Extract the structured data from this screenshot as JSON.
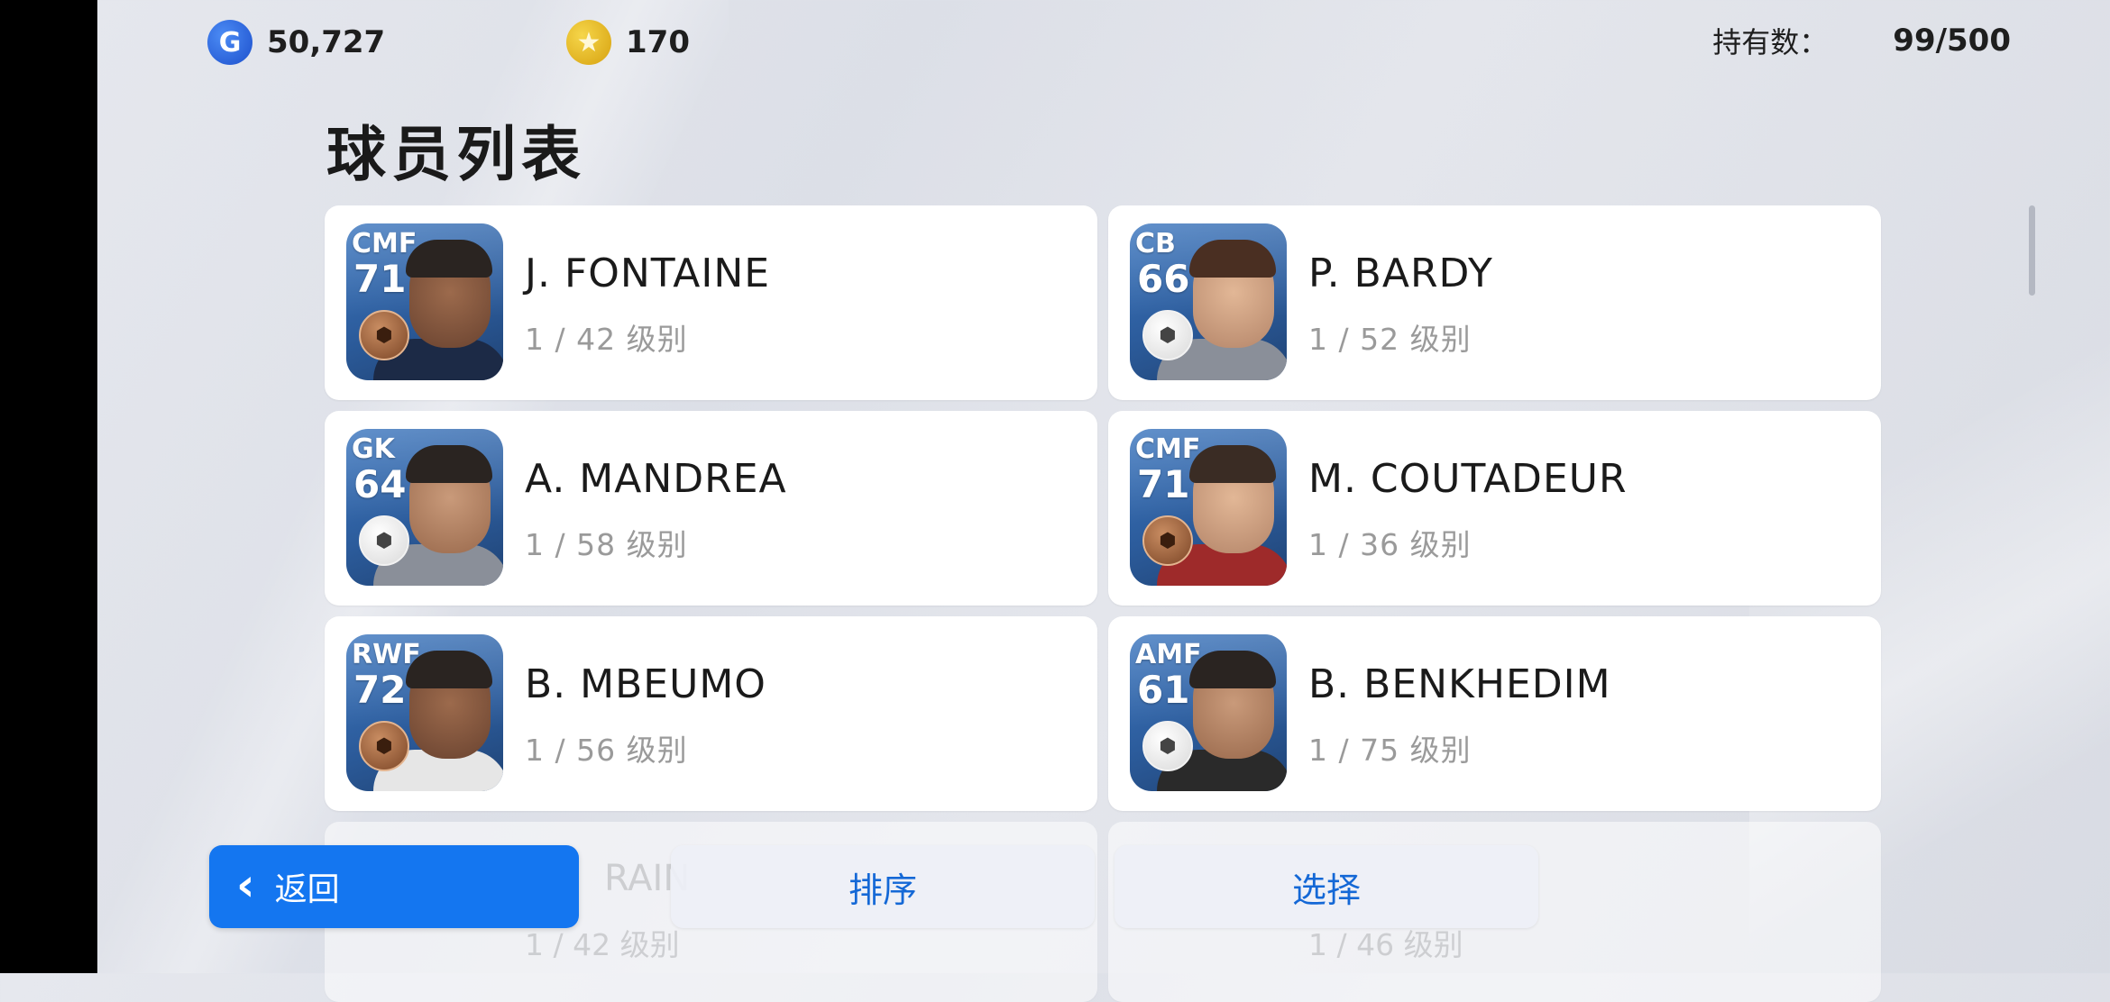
{
  "currency": {
    "gp_icon": "G",
    "gp": "50,727",
    "coins_icon": "★",
    "coins": "170"
  },
  "owned": {
    "label": "持有数：",
    "value": "99/500"
  },
  "page_title": "球员列表",
  "players": [
    {
      "position": "CMF",
      "rating": "71",
      "name": "J. FONTAINE",
      "level": "1 / 42 级别",
      "badge": "bronze",
      "icon": "player-portrait"
    },
    {
      "position": "CB",
      "rating": "66",
      "name": "P. BARDY",
      "level": "1 / 52 级别",
      "badge": "white",
      "icon": "player-portrait"
    },
    {
      "position": "GK",
      "rating": "64",
      "name": "A. MANDREA",
      "level": "1 / 58 级别",
      "badge": "white",
      "icon": "player-portrait"
    },
    {
      "position": "CMF",
      "rating": "71",
      "name": "M. COUTADEUR",
      "level": "1 / 36 级别",
      "badge": "bronze",
      "icon": "player-portrait"
    },
    {
      "position": "RWF",
      "rating": "72",
      "name": "B. MBEUMO",
      "level": "1 / 56 级别",
      "badge": "bronze",
      "icon": "player-portrait"
    },
    {
      "position": "AMF",
      "rating": "61",
      "name": "B. BENKHEDIM",
      "level": "1 / 75 级别",
      "badge": "white",
      "icon": "player-portrait"
    }
  ],
  "partial_rows": [
    {
      "name_fragment": "RAIN",
      "level": "1 / 42 级别"
    },
    {
      "name_fragment": "",
      "level": "1 / 46 级别"
    }
  ],
  "buttons": {
    "back": "返回",
    "sort": "排序",
    "select": "选择"
  },
  "colors": {
    "accent": "#1476f0",
    "portrait_bg": "#2c5c9c",
    "bronze_badge": "#a8683f"
  }
}
